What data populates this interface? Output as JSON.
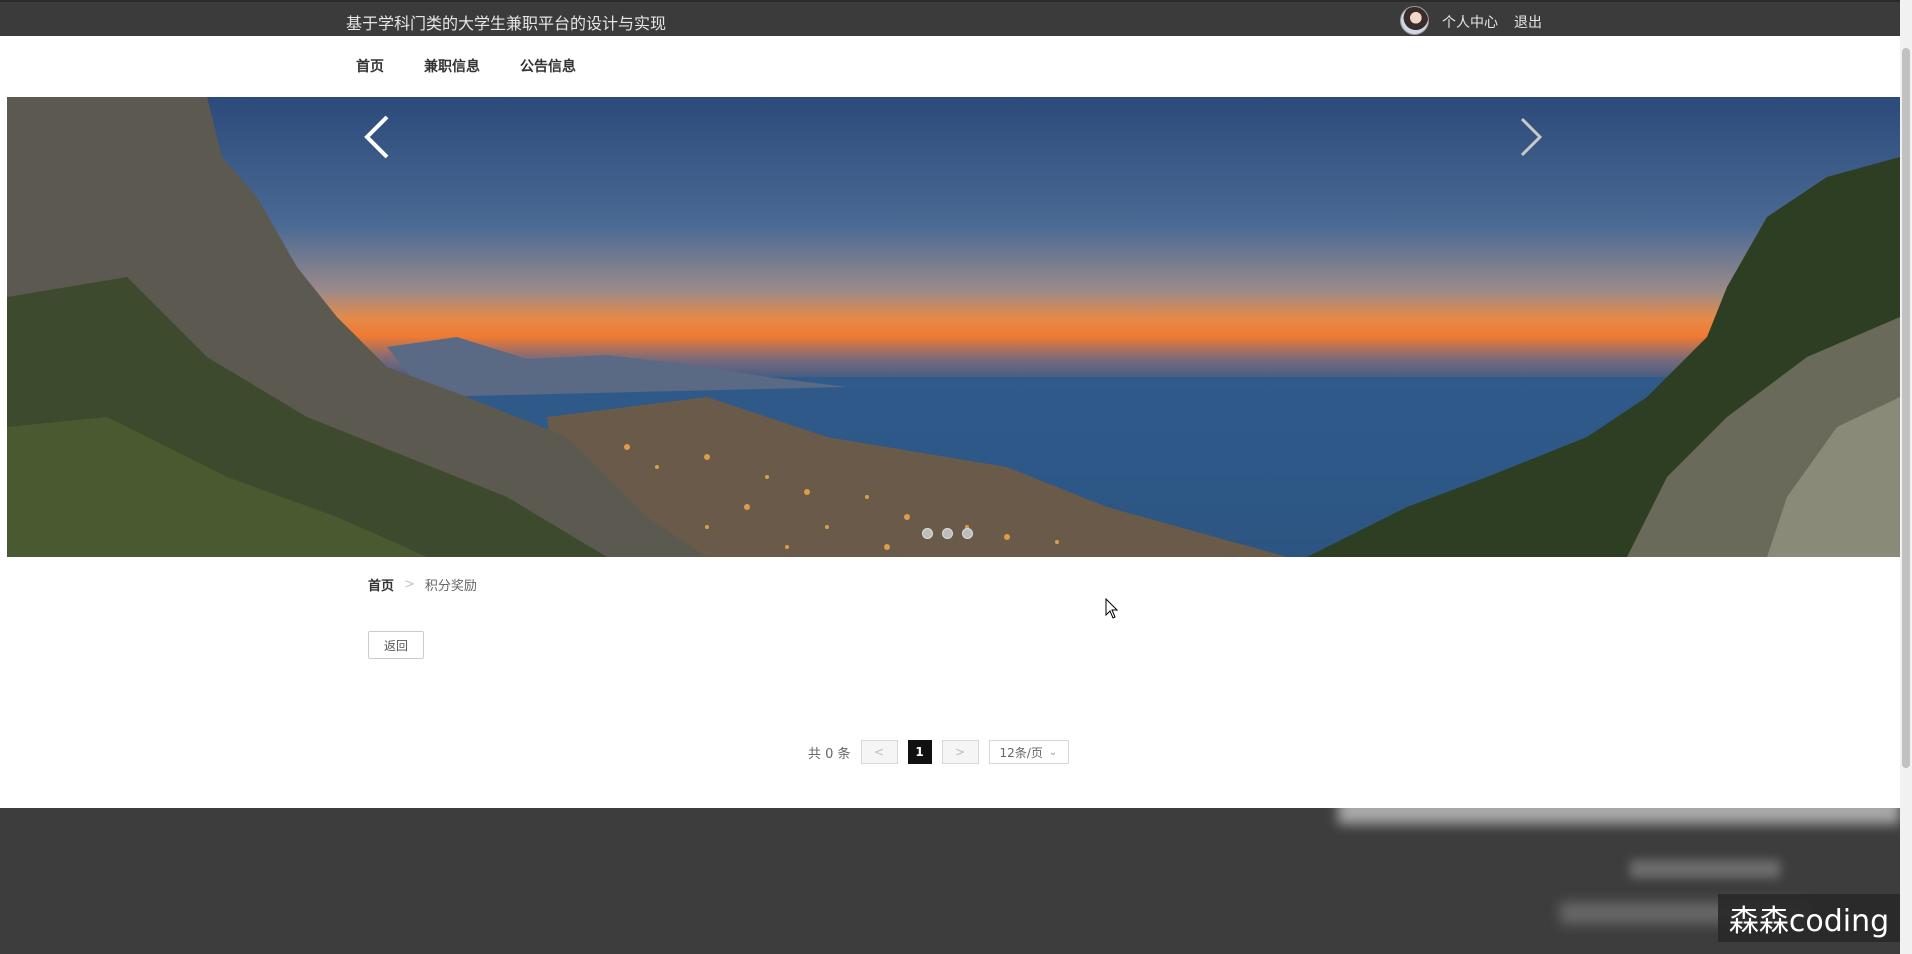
{
  "header": {
    "site_title": "基于学科门类的大学生兼职平台的设计与实现",
    "user_center": "个人中心",
    "logout": "退出"
  },
  "nav": {
    "items": [
      {
        "label": "首页"
      },
      {
        "label": "兼职信息"
      },
      {
        "label": "公告信息"
      }
    ]
  },
  "banner": {
    "slide_count": 3,
    "active_slide": 1
  },
  "breadcrumb": {
    "home": "首页",
    "separator": ">",
    "current": "积分奖励"
  },
  "actions": {
    "back": "返回"
  },
  "pagination": {
    "total_text": "共 0 条",
    "prev": "<",
    "next": ">",
    "current_page": "1",
    "page_size": "12条/页"
  },
  "watermark": {
    "text": "森森coding"
  },
  "colors": {
    "topbar": "#3b3b3b",
    "footer": "#3d3d3d",
    "active_page": "#111111"
  }
}
